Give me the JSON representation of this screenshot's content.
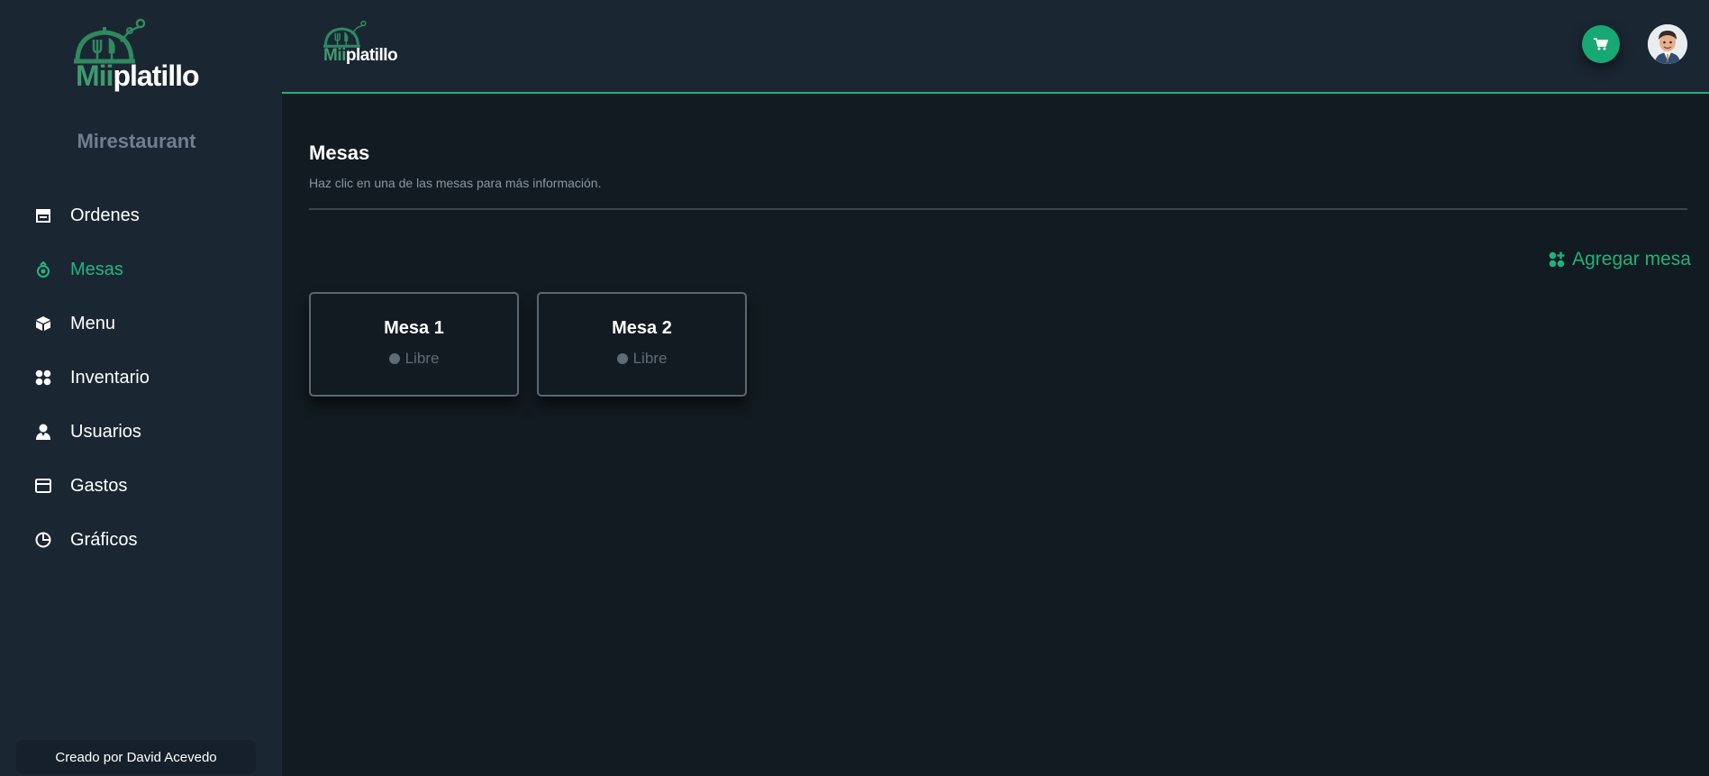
{
  "brand": {
    "name_part1": "Mii",
    "name_part2": "platillo"
  },
  "sidebar": {
    "restaurant_name": "Mirestaurant",
    "items": [
      {
        "label": "Ordenes",
        "icon": "store-icon",
        "active": false
      },
      {
        "label": "Mesas",
        "icon": "table-icon",
        "active": true
      },
      {
        "label": "Menu",
        "icon": "cube-icon",
        "active": false
      },
      {
        "label": "Inventario",
        "icon": "grid-icon",
        "active": false
      },
      {
        "label": "Usuarios",
        "icon": "user-icon",
        "active": false
      },
      {
        "label": "Gastos",
        "icon": "wallet-icon",
        "active": false
      },
      {
        "label": "Gráficos",
        "icon": "pie-chart-icon",
        "active": false
      }
    ],
    "footer": "Creado por David Acevedo"
  },
  "header": {
    "cart_icon": "cart-icon",
    "avatar_icon": "user-avatar"
  },
  "main": {
    "title": "Mesas",
    "subtitle": "Haz clic en una de las mesas para más información.",
    "add_button": "Agregar mesa",
    "tables": [
      {
        "name": "Mesa 1",
        "status": "Libre"
      },
      {
        "name": "Mesa 2",
        "status": "Libre"
      }
    ]
  },
  "colors": {
    "accent": "#1fb37a",
    "sidebar_bg": "#1b2633",
    "main_bg": "#121b21",
    "status_free": "#5f6b77"
  }
}
